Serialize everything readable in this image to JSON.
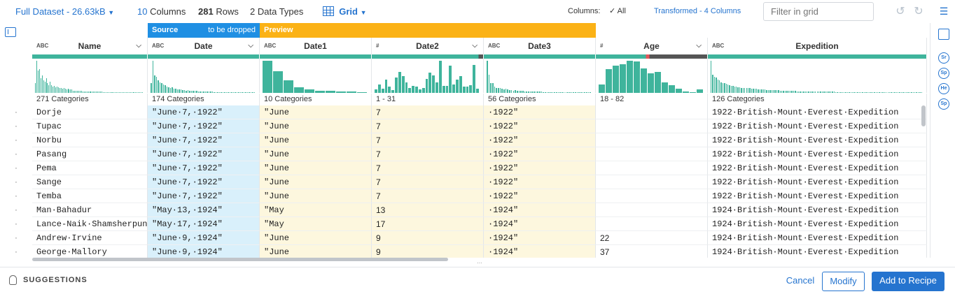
{
  "topbar": {
    "dataset": "Full Dataset - 26.63kB",
    "columns_count": "10",
    "columns_label": "Columns",
    "rows_count": "281",
    "rows_label": "Rows",
    "types_count": "2",
    "types_label": "Data Types",
    "view": "Grid",
    "columns_filter_label": "Columns:",
    "columns_filter_value": "All",
    "transformed": "Transformed - 4 Columns",
    "filter_placeholder": "Filter in grid"
  },
  "banners": {
    "source": "Source",
    "source_note": "to be dropped",
    "preview": "Preview"
  },
  "columns": [
    {
      "name": "Name",
      "type": "ABC",
      "summary": "271 Categories"
    },
    {
      "name": "Date",
      "type": "ABC",
      "summary": "174 Categories"
    },
    {
      "name": "Date1",
      "type": "ABC",
      "summary": "10 Categories"
    },
    {
      "name": "Date2",
      "type": "#",
      "summary": "1 - 31"
    },
    {
      "name": "Date3",
      "type": "ABC",
      "summary": "56 Categories"
    },
    {
      "name": "Age",
      "type": "#",
      "summary": "18 - 82"
    },
    {
      "name": "Expedition",
      "type": "ABC",
      "summary": "126 Categories"
    }
  ],
  "rows": [
    [
      "Dorje",
      "\"June·7,·1922\"",
      "\"June",
      "7",
      "·1922\"",
      "",
      "1922·British·Mount·Everest·Expedition"
    ],
    [
      "Tupac",
      "\"June·7,·1922\"",
      "\"June",
      "7",
      "·1922\"",
      "",
      "1922·British·Mount·Everest·Expedition"
    ],
    [
      "Norbu",
      "\"June·7,·1922\"",
      "\"June",
      "7",
      "·1922\"",
      "",
      "1922·British·Mount·Everest·Expedition"
    ],
    [
      "Pasang",
      "\"June·7,·1922\"",
      "\"June",
      "7",
      "·1922\"",
      "",
      "1922·British·Mount·Everest·Expedition"
    ],
    [
      "Pema",
      "\"June·7,·1922\"",
      "\"June",
      "7",
      "·1922\"",
      "",
      "1922·British·Mount·Everest·Expedition"
    ],
    [
      "Sange",
      "\"June·7,·1922\"",
      "\"June",
      "7",
      "·1922\"",
      "",
      "1922·British·Mount·Everest·Expedition"
    ],
    [
      "Temba",
      "\"June·7,·1922\"",
      "\"June",
      "7",
      "·1922\"",
      "",
      "1922·British·Mount·Everest·Expedition"
    ],
    [
      "Man·Bahadur",
      "\"May·13,·1924\"",
      "\"May",
      "13",
      "·1924\"",
      "",
      "1924·British·Mount·Everest·Expedition"
    ],
    [
      "Lance-Naik·Shamsherpun",
      "\"May·17,·1924\"",
      "\"May",
      "17",
      "·1924\"",
      "",
      "1924·British·Mount·Everest·Expedition"
    ],
    [
      "Andrew·Irvine",
      "\"June·9,·1924\"",
      "\"June",
      "9",
      "·1924\"",
      "22",
      "1924·British·Mount·Everest·Expedition"
    ],
    [
      "George·Mallory",
      "\"June·9,·1924\"",
      "\"June",
      "9",
      "·1924\"",
      "37",
      "1924·British·Mount·Everest·Expedition"
    ]
  ],
  "row_marker": "·",
  "histograms": [
    [
      12,
      40,
      28,
      30,
      18,
      22,
      16,
      14,
      18,
      12,
      10,
      14,
      10,
      8,
      9,
      7,
      8,
      7,
      6,
      6,
      5,
      6,
      5,
      4,
      5,
      4,
      4,
      4,
      3,
      3,
      3,
      3,
      3,
      3,
      3,
      2,
      2,
      2,
      2,
      2,
      2,
      2,
      2,
      2,
      2,
      2,
      2,
      2,
      2,
      2,
      1,
      1,
      1,
      1,
      1,
      1,
      1,
      1,
      1,
      1,
      1,
      1,
      1,
      1,
      1,
      1,
      1,
      1,
      1,
      1,
      1,
      1,
      1,
      1,
      1,
      1,
      1,
      1,
      1,
      1
    ],
    [
      28,
      92,
      50,
      46,
      36,
      30,
      28,
      24,
      22,
      18,
      16,
      14,
      16,
      12,
      12,
      10,
      10,
      10,
      8,
      8,
      7,
      8,
      7,
      6,
      6,
      6,
      6,
      5,
      5,
      5,
      4,
      4,
      4,
      4,
      4,
      4,
      3,
      3,
      3,
      3,
      3,
      3,
      3,
      3,
      3,
      3,
      3,
      3,
      2,
      2,
      2,
      2,
      2,
      2,
      2,
      2,
      2,
      2,
      2,
      2
    ],
    [
      95,
      64,
      38,
      16,
      10,
      6,
      6,
      4,
      4,
      3
    ],
    [
      10,
      25,
      12,
      40,
      18,
      8,
      45,
      62,
      50,
      30,
      14,
      20,
      18,
      10,
      15,
      42,
      60,
      52,
      30,
      95,
      20,
      20,
      80,
      25,
      40,
      50,
      18,
      18,
      22,
      82,
      12
    ],
    [
      98,
      55,
      30,
      30,
      20,
      14,
      16,
      14,
      12,
      10,
      12,
      10,
      8,
      8,
      7,
      8,
      6,
      6,
      6,
      6,
      5,
      5,
      5,
      5,
      4,
      4,
      4,
      4,
      4,
      4,
      3,
      3,
      3,
      3,
      3,
      3,
      3,
      3,
      3,
      3,
      3,
      3,
      3,
      3,
      3,
      3,
      3,
      3,
      3,
      3,
      3,
      3,
      3,
      3,
      3,
      3
    ],
    [
      25,
      70,
      80,
      85,
      95,
      92,
      72,
      58,
      62,
      32,
      22,
      12,
      5,
      3,
      10
    ],
    [
      98,
      55,
      50,
      46,
      40,
      38,
      32,
      30,
      30,
      28,
      26,
      24,
      22,
      22,
      20,
      20,
      18,
      18,
      16,
      16,
      16,
      14,
      14,
      14,
      13,
      12,
      12,
      12,
      11,
      11,
      10,
      10,
      10,
      9,
      9,
      9,
      9,
      8,
      8,
      8,
      8,
      7,
      7,
      7,
      7,
      6,
      6,
      6,
      6,
      6,
      6,
      5,
      5,
      5,
      5,
      5,
      5,
      5,
      5,
      5,
      4,
      4,
      4,
      4,
      4,
      4,
      4,
      4,
      4,
      4,
      4,
      4,
      4,
      4,
      3,
      3,
      3,
      3,
      3,
      3,
      3,
      3,
      3,
      3,
      3,
      3,
      3,
      3,
      3,
      3,
      3,
      3,
      3,
      3,
      3,
      3,
      3,
      3,
      3,
      3,
      3,
      3,
      3,
      3,
      3,
      3,
      3,
      3,
      3,
      3,
      3,
      3,
      3,
      3,
      3,
      3,
      3,
      3,
      3,
      3,
      3,
      3,
      3,
      3,
      3,
      3
    ]
  ],
  "bottom": {
    "suggestions": "SUGGESTIONS",
    "cancel": "Cancel",
    "modify": "Modify",
    "add": "Add to Recipe"
  },
  "right_icons": [
    "Sr",
    "Sp",
    "He",
    "Sp"
  ],
  "colors": {
    "accent": "#2574cf",
    "source": "#1f8fe3",
    "preview": "#fbb216",
    "bar": "#3fb49c",
    "source_bg": "#d9f0fb",
    "preview_bg": "#fdf7de"
  }
}
